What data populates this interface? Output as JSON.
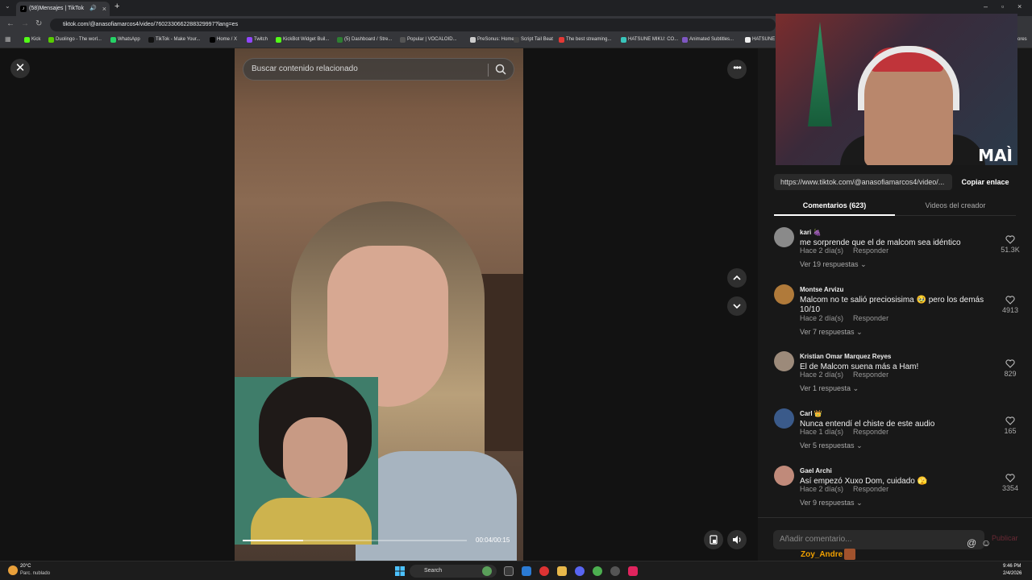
{
  "browser": {
    "tab_title": "(58)Mensajes | TikTok",
    "tab_favicon": "tiktok-icon",
    "url": "tiktok.com/@anasofiamarcos4/video/7602330662288329997?lang=es",
    "bookmarks": [
      {
        "label": "Kick",
        "color": "#53fc18"
      },
      {
        "label": "Duolingo - The worl...",
        "color": "#58cc02"
      },
      {
        "label": "WhatsApp",
        "color": "#25d366"
      },
      {
        "label": "TikTok - Make Your...",
        "color": "#111111"
      },
      {
        "label": "Home / X",
        "color": "#000000"
      },
      {
        "label": "Twitch",
        "color": "#9146ff"
      },
      {
        "label": "KickBot Widget Buil...",
        "color": "#53fc18"
      },
      {
        "label": "(5) Dashboard / Stre...",
        "color": "#2e7d32"
      },
      {
        "label": "Popular | VOCALOID...",
        "color": "#555555"
      },
      {
        "label": "PreSonus: Home",
        "color": "#cccccc"
      },
      {
        "label": "Script Tail Beat",
        "color": "#444444"
      },
      {
        "label": "The best streaming...",
        "color": "#e53935"
      },
      {
        "label": "HATSUNE MIKU: CO...",
        "color": "#39c5bb"
      },
      {
        "label": "Animated Subtitles...",
        "color": "#7e57c2"
      },
      {
        "label": "HATSUNE",
        "color": "#eeeeee"
      }
    ],
    "bookmarks_more": "ores"
  },
  "video": {
    "search_placeholder": "Buscar contenido relacionado",
    "time": "00:04/00:15",
    "progress": 0.27
  },
  "panel": {
    "webcam_logo": "MAÌ",
    "link": "https://www.tiktok.com/@anasofiamarcos4/video/...",
    "copy_link": "Copiar enlace",
    "tab_comments": "Comentarios (623)",
    "tab_creator": "Videos del creador",
    "reply_label": "Responder",
    "comment_placeholder": "Añadir comentario...",
    "publish": "Publicar",
    "live_chat_user": "Zoy_Andre"
  },
  "comments": [
    {
      "name": "kari 🍇",
      "text": "me sorprende que el de malcom sea idéntico",
      "time": "Hace 2 día(s)",
      "replies": "Ver 19 respuestas",
      "likes": "51.3K",
      "avatar_color": "#8a8a8a"
    },
    {
      "name": "Montse Arvizu",
      "text": "Malcom no te salió preciosisima 🥹 pero los demás 10/10",
      "time": "Hace 2 día(s)",
      "replies": "Ver 7 respuestas",
      "likes": "4913",
      "avatar_color": "#b07a3a"
    },
    {
      "name": "Kristian Omar Marquez Reyes",
      "text": "El de Malcom suena más a Ham!",
      "time": "Hace 2 día(s)",
      "replies": "Ver 1 respuesta",
      "likes": "829",
      "avatar_color": "#9c8a7a"
    },
    {
      "name": "Carl 👑",
      "text": "Nunca entendí el chiste de este audio",
      "time": "Hace 1 día(s)",
      "replies": "Ver 5 respuestas",
      "likes": "165",
      "avatar_color": "#3a5a8a"
    },
    {
      "name": "Gael Archi",
      "text": "Así empezó Xuxo Dom, cuidado 🫣",
      "time": "Hace 2 día(s)",
      "replies": "Ver 9 respuestas",
      "likes": "3354",
      "avatar_color": "#c08a7a"
    }
  ],
  "taskbar": {
    "temp": "20°C",
    "weather": "Parc. nublado",
    "search": "Search",
    "time": "9:46 PM",
    "date": "2/4/2026"
  }
}
